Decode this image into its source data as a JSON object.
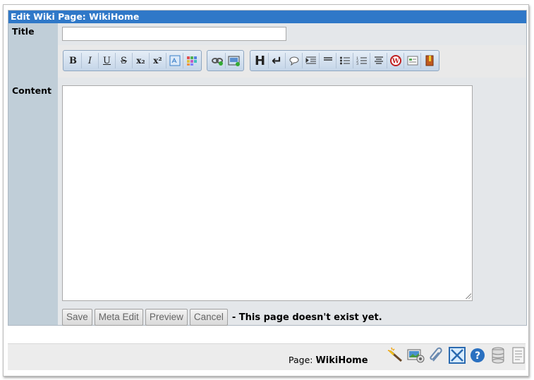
{
  "window": {
    "title": "Edit Wiki Page: WikiHome"
  },
  "form": {
    "title_label": "Title",
    "title_value": "",
    "content_label": "Content",
    "content_value": ""
  },
  "toolbar": {
    "group1": [
      {
        "icon": "bold-icon",
        "glyph": "B"
      },
      {
        "icon": "italic-icon",
        "glyph": "I"
      },
      {
        "icon": "underline-icon",
        "glyph": "U"
      },
      {
        "icon": "strikethrough-icon",
        "glyph": "S"
      },
      {
        "icon": "subscript-icon",
        "glyph": "x₂"
      },
      {
        "icon": "superscript-icon",
        "glyph": "x²"
      },
      {
        "icon": "insert-special-icon",
        "glyph": ""
      },
      {
        "icon": "color-palette-icon",
        "glyph": ""
      }
    ],
    "group2": [
      {
        "icon": "insert-link-icon",
        "glyph": ""
      },
      {
        "icon": "insert-image-icon",
        "glyph": ""
      }
    ],
    "group3": [
      {
        "icon": "heading-icon",
        "glyph": "H"
      },
      {
        "icon": "line-break-icon",
        "glyph": "↵"
      },
      {
        "icon": "comment-icon",
        "glyph": ""
      },
      {
        "icon": "indent-icon",
        "glyph": ""
      },
      {
        "icon": "horizontal-rule-icon",
        "glyph": ""
      },
      {
        "icon": "bullet-list-icon",
        "glyph": ""
      },
      {
        "icon": "numbered-list-icon",
        "glyph": ""
      },
      {
        "icon": "center-align-icon",
        "glyph": ""
      },
      {
        "icon": "wikipedia-icon",
        "glyph": "W"
      },
      {
        "icon": "template-icon",
        "glyph": ""
      },
      {
        "icon": "book-icon",
        "glyph": ""
      }
    ]
  },
  "buttons": {
    "save": "Save",
    "meta_edit": "Meta Edit",
    "preview": "Preview",
    "cancel": "Cancel"
  },
  "status_text": "- This page doesn't exist yet.",
  "footer": {
    "page_label": "Page:",
    "page_name": "WikiHome",
    "icons": [
      "magic-wand-icon",
      "image-gallery-icon",
      "attachment-icon",
      "expand-icon",
      "help-icon",
      "database-icon",
      "document-icon"
    ]
  }
}
